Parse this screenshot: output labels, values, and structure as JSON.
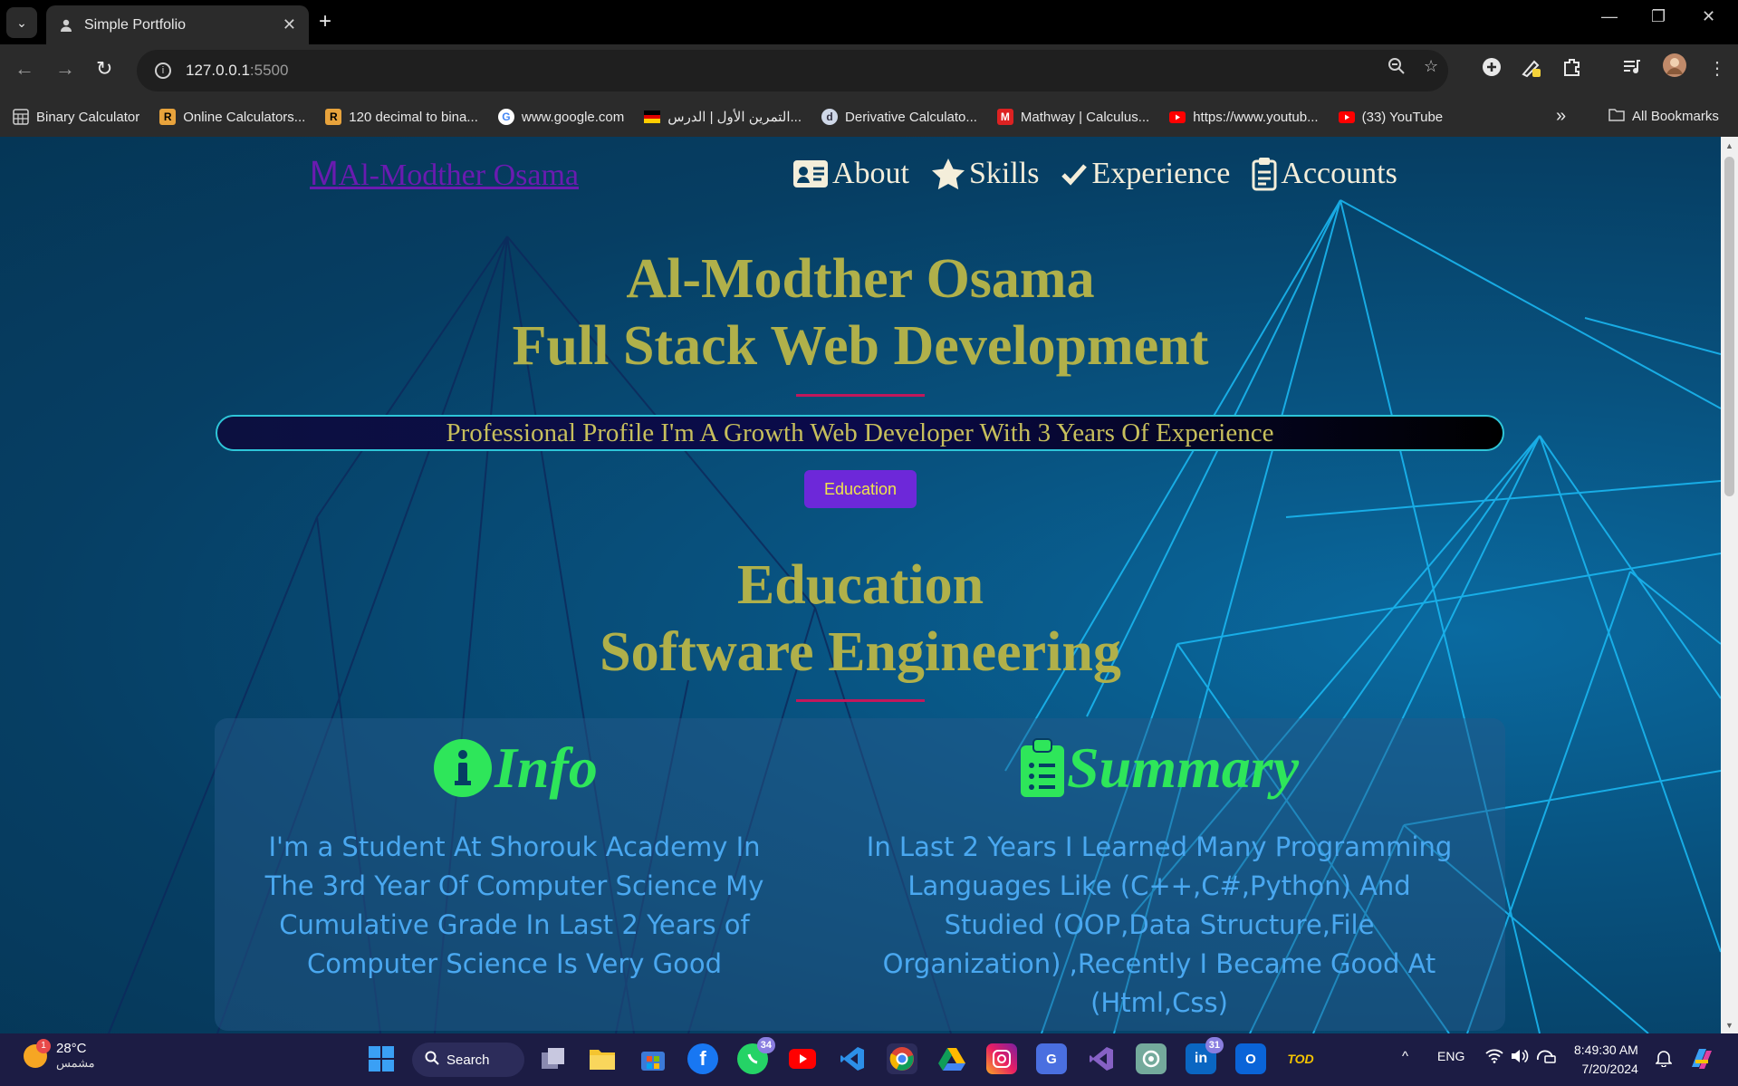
{
  "browser": {
    "tab_title": "Simple Portfolio",
    "url_host": "127.0.0.1",
    "url_port": ":5500",
    "bookmarks": [
      {
        "label": "Binary Calculator",
        "icon": "calculator-icon",
        "color": "#9aa0a6"
      },
      {
        "label": "Online Calculators...",
        "icon": "r-logo-icon",
        "color": "#e8a33c"
      },
      {
        "label": "120 decimal to bina...",
        "icon": "r-logo-icon",
        "color": "#e8a33c"
      },
      {
        "label": "www.google.com",
        "icon": "google-icon",
        "color": "#ffffff"
      },
      {
        "label": "التمرين الأول | الدرس...",
        "icon": "germany-flag-icon",
        "color": "#d33"
      },
      {
        "label": "Derivative Calculato...",
        "icon": "derivative-icon",
        "color": "#9ab0d0"
      },
      {
        "label": "Mathway | Calculus...",
        "icon": "mathway-icon",
        "color": "#d22"
      },
      {
        "label": "https://www.youtub...",
        "icon": "youtube-icon",
        "color": "#ff0000"
      },
      {
        "label": "(33) YouTube",
        "icon": "youtube-icon",
        "color": "#ff0000"
      }
    ],
    "all_bookmarks": "All Bookmarks"
  },
  "site": {
    "logo_letter": "M",
    "logo_text": "Al-Modther Osama",
    "nav": [
      {
        "label": "About",
        "icon": "id-card-icon"
      },
      {
        "label": "Skills",
        "icon": "star-icon"
      },
      {
        "label": "Experience",
        "icon": "check-icon"
      },
      {
        "label": "Accounts",
        "icon": "clipboard-icon"
      }
    ],
    "hero_line1": "Al-Modther Osama",
    "hero_line2": "Full Stack Web Development",
    "profile_text": "Professional Profile I'm A Growth Web Developer With 3 Years Of Experience",
    "education_button": "Education",
    "edu_line1": "Education",
    "edu_line2": "Software Engineering",
    "info_title": "Info",
    "info_text": "I'm a Student At Shorouk Academy In The 3rd Year Of Computer Science My Cumulative Grade In Last 2 Years of Computer Science Is Very Good",
    "summary_title": "Summary",
    "summary_text": "In Last 2 Years I Learned Many Programming Languages Like (C++,C#,Python) And Studied (OOP,Data Structure,File Organization) ,Recently I Became Good At (Html,Css)",
    "colors": {
      "accent_gold": "#b0b04a",
      "title_green": "#2ee65a",
      "text_blue": "#4aa8f0",
      "button_purple": "#6d28d9"
    }
  },
  "taskbar": {
    "weather_temp": "28°C",
    "weather_desc": "مشمس",
    "weather_badge": "1",
    "search_label": "Search",
    "whatsapp_badge": "34",
    "linkedin_badge": "31",
    "lang": "ENG",
    "time": "8:49:30 AM",
    "date": "7/20/2024"
  }
}
